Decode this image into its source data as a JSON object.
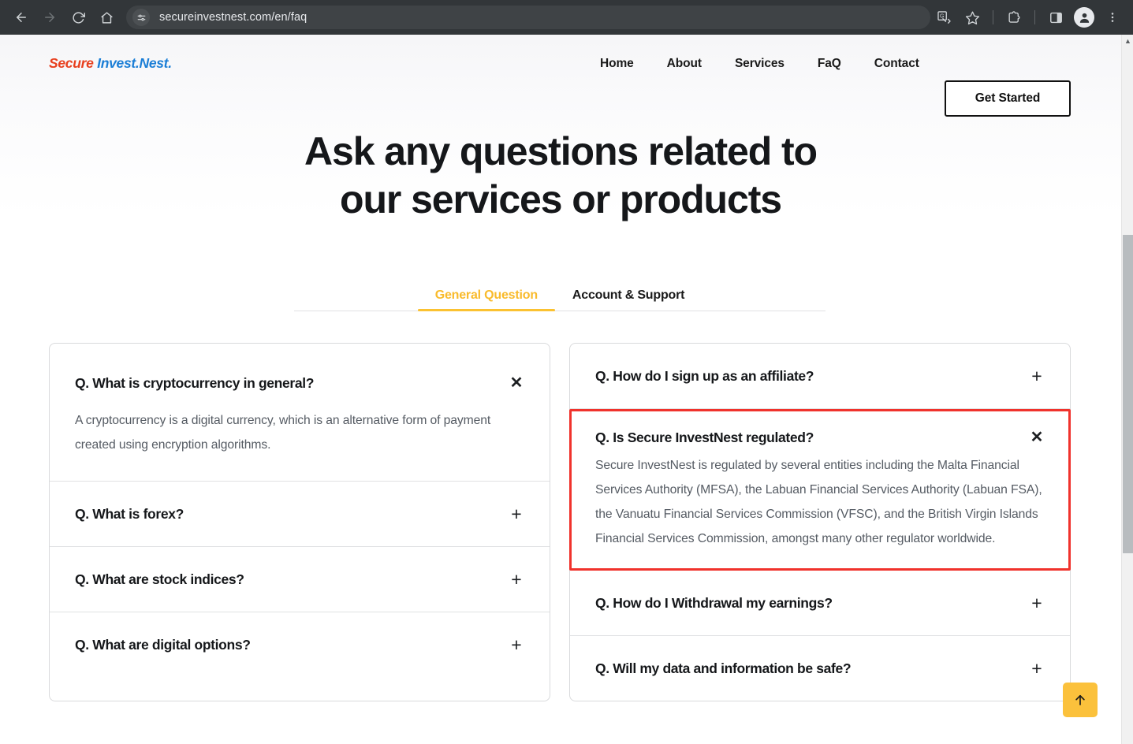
{
  "browser": {
    "url": "secureinvestnest.com/en/faq",
    "back_label": "Back",
    "forward_label": "Forward",
    "reload_label": "Reload",
    "home_label": "Home",
    "site_info_label": "View site information",
    "translate_label": "Translate this page",
    "bookmark_label": "Bookmark this tab",
    "extensions_label": "Extensions",
    "side_panel_label": "Side panel",
    "profile_label": "Profile",
    "menu_label": "Customize and control Chrome"
  },
  "site": {
    "logo": {
      "part1": "Secure ",
      "part2": "Invest.Nest.",
      "color1": "#e8401f",
      "color2": "#1b7ed6"
    },
    "nav": [
      {
        "label": "Home"
      },
      {
        "label": "About"
      },
      {
        "label": "Services"
      },
      {
        "label": "FaQ"
      },
      {
        "label": "Contact"
      }
    ],
    "cta": {
      "label": "Get Started"
    }
  },
  "hero": {
    "line1": "Ask any questions related to",
    "line2": "our services or products"
  },
  "tabs": {
    "active_index": 0,
    "active_color": "#fbc231",
    "items": [
      {
        "label": "General Question"
      },
      {
        "label": "Account & Support"
      }
    ]
  },
  "faq": {
    "expand_glyph": "+",
    "collapse_glyph": "✕",
    "left_column": [
      {
        "question": "Q. What is cryptocurrency in general?",
        "expanded": true,
        "answer": "A cryptocurrency is a digital currency, which is an alternative form of payment created using encryption algorithms."
      },
      {
        "question": "Q. What is forex?",
        "expanded": false,
        "answer": ""
      },
      {
        "question": "Q. What are stock indices?",
        "expanded": false,
        "answer": ""
      },
      {
        "question": "Q. What are digital options?",
        "expanded": false,
        "answer": ""
      }
    ],
    "right_column": [
      {
        "question": "Q. How do I sign up as an affiliate?",
        "expanded": false,
        "answer": ""
      },
      {
        "question": "Q. Is Secure InvestNest regulated?",
        "expanded": true,
        "highlighted": true,
        "highlight_color": "#f0322c",
        "answer": "Secure InvestNest is regulated by several entities including the Malta Financial Services Authority (MFSA), the Labuan Financial Services Authority (Labuan FSA), the Vanuatu Financial Services Commission (VFSC), and the British Virgin Islands Financial Services Commission, amongst many other regulator worldwide."
      },
      {
        "question": "Q. How do I Withdrawal my earnings?",
        "expanded": false,
        "answer": ""
      },
      {
        "question": "Q. Will my data and information be safe?",
        "expanded": false,
        "answer": ""
      }
    ]
  },
  "scroll_top": {
    "label": "↑",
    "color": "#fbc13c"
  }
}
